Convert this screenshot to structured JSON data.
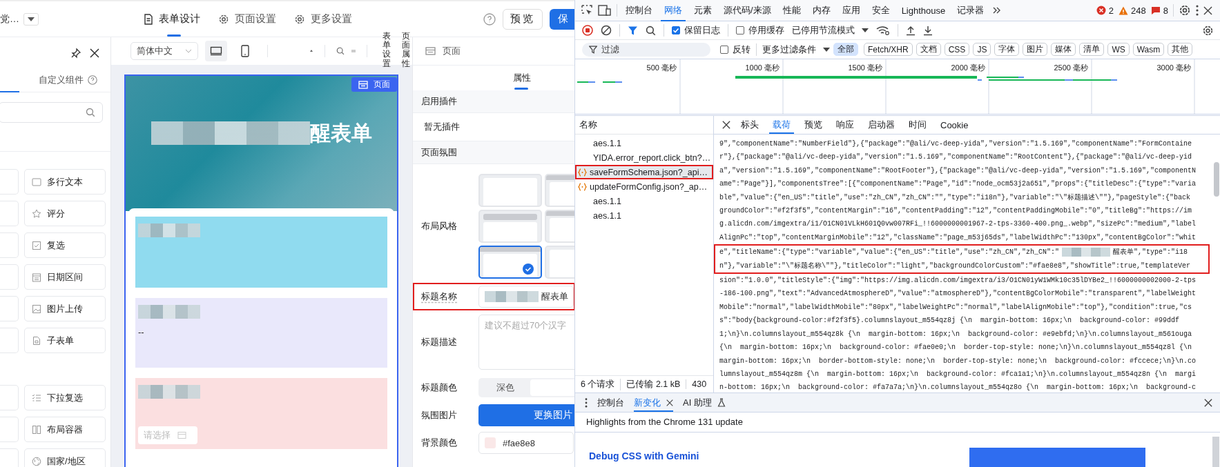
{
  "app": {
    "app_name": "党…",
    "tabs": [
      {
        "label": "表单设计",
        "selected": true
      },
      {
        "label": "页面设置",
        "selected": false
      },
      {
        "label": "更多设置",
        "selected": false
      }
    ],
    "preview_button": "预览",
    "save_button": "保",
    "component_panel": {
      "tab": "自定义组件",
      "groups": [
        [
          {
            "label": "多行文本"
          },
          {
            "label": "评分"
          },
          {
            "label": "复选"
          },
          {
            "label": "日期区间"
          },
          {
            "label": "图片上传"
          },
          {
            "label": "子表单"
          }
        ],
        [
          {
            "label": "下拉复选"
          },
          {
            "label": "布局容器"
          },
          {
            "label": "国家/地区"
          }
        ]
      ]
    },
    "canvas": {
      "language": "简体中文",
      "devices": [
        {
          "kind": "desktop",
          "selected": true
        },
        {
          "kind": "mobile",
          "selected": false
        }
      ],
      "side_labels": [
        "表单设置",
        "页面属性"
      ],
      "page_badge": "页面",
      "title_visible": "醒表单",
      "sections": [
        {
          "kind": "blank",
          "color": "#90dbef"
        },
        {
          "kind": "dash",
          "color": "#e9e8fb",
          "text": "--"
        },
        {
          "kind": "select",
          "color": "#fbdfe0",
          "placeholder": "请选择"
        }
      ]
    },
    "properties": {
      "header": "页面",
      "tab": "属性",
      "plugin_section": "启用插件",
      "plugin_empty": "暂无插件",
      "atmosphere_section": "页面氛围",
      "layout_label": "布局风格",
      "layout_styles": [
        {
          "kind": "plain",
          "selected": false
        },
        {
          "kind": "bar",
          "selected": false
        },
        {
          "kind": "inset-bar",
          "selected": false
        },
        {
          "kind": "bar",
          "selected": false
        },
        {
          "kind": "band",
          "selected": true
        },
        {
          "kind": "plain",
          "selected": false
        }
      ],
      "title_name": {
        "label": "标题名称",
        "value": "醒表单",
        "highlighted": true
      },
      "title_desc": {
        "label": "标题描述",
        "placeholder": "建议不超过70个汉字"
      },
      "title_color": {
        "label": "标题颜色",
        "options": [
          {
            "label": "深色",
            "selected": false
          },
          {
            "selected": true
          }
        ]
      },
      "atmosphere_image": {
        "label": "氛围图片",
        "button": "更换图片"
      },
      "background_color": {
        "label": "背景颜色",
        "value": "#fae8e8",
        "color": "#fae8e8"
      }
    }
  },
  "devtools": {
    "tabs": [
      {
        "label": "控制台",
        "selected": false
      },
      {
        "label": "网络",
        "selected": true
      },
      {
        "label": "元素",
        "selected": false
      },
      {
        "label": "源代码/来源",
        "selected": false
      },
      {
        "label": "性能",
        "selected": false
      },
      {
        "label": "内存",
        "selected": false
      },
      {
        "label": "应用",
        "selected": false
      },
      {
        "label": "安全",
        "selected": false
      },
      {
        "label": "Lighthouse",
        "selected": false
      },
      {
        "label": "记录器",
        "selected": false
      }
    ],
    "counts": [
      {
        "kind": "error",
        "value": "2"
      },
      {
        "kind": "warning",
        "value": "248"
      },
      {
        "kind": "issue",
        "value": "8"
      }
    ],
    "preserve_log": {
      "label": "保留日志",
      "checked": true
    },
    "disable_cache": {
      "label": "停用缓存",
      "checked": false
    },
    "throttling": "已停用节流模式",
    "filter": {
      "placeholder": "过滤",
      "invert": {
        "label": "反转",
        "checked": false
      },
      "more_filters": "更多过滤条件",
      "types": [
        {
          "label": "全部",
          "selected": true
        },
        {
          "label": "Fetch/XHR",
          "selected": false
        },
        {
          "label": "文档",
          "selected": false
        },
        {
          "label": "CSS",
          "selected": false
        },
        {
          "label": "JS",
          "selected": false
        },
        {
          "label": "字体",
          "selected": false
        },
        {
          "label": "图片",
          "selected": false
        },
        {
          "label": "媒体",
          "selected": false
        },
        {
          "label": "清单",
          "selected": false
        },
        {
          "label": "WS",
          "selected": false
        },
        {
          "label": "Wasm",
          "selected": false
        },
        {
          "label": "其他",
          "selected": false
        }
      ]
    },
    "timeline_ticks": [
      "500 毫秒",
      "1000 毫秒",
      "1500 毫秒",
      "2000 毫秒",
      "2500 毫秒",
      "3000 毫秒"
    ],
    "requests": {
      "header": "名称",
      "rows": [
        {
          "name": "aes.1.1",
          "kind": "plain",
          "selected": false,
          "highlighted": false
        },
        {
          "name": "YIDA.error_report.click_btn?…",
          "kind": "plain",
          "selected": false,
          "highlighted": false
        },
        {
          "name": "saveFormSchema.json?_api…",
          "kind": "json",
          "selected": true,
          "highlighted": true
        },
        {
          "name": "updateFormConfig.json?_ap…",
          "kind": "json",
          "selected": false,
          "highlighted": false
        },
        {
          "name": "aes.1.1",
          "kind": "plain",
          "selected": false,
          "highlighted": false
        },
        {
          "name": "aes.1.1",
          "kind": "plain",
          "selected": false,
          "highlighted": false
        }
      ],
      "summary": [
        "6 个请求",
        "已传输 2.1 kB",
        "430"
      ]
    },
    "detail": {
      "tabs": [
        {
          "label": "标头",
          "selected": false
        },
        {
          "label": "载荷",
          "selected": true
        },
        {
          "label": "预览",
          "selected": false
        },
        {
          "label": "响应",
          "selected": false
        },
        {
          "label": "启动器",
          "selected": false
        },
        {
          "label": "时间",
          "selected": false
        },
        {
          "label": "Cookie",
          "selected": false
        }
      ],
      "payload_lines": [
        {
          "text": "9\",\"componentName\":\"NumberField\"},{\"package\":\"@ali/vc-deep-yida\",\"version\":\"1.5.169\",\"componentName\":\"FormContaine",
          "highlighted": false
        },
        {
          "text": "r\"},{\"package\":\"@ali/vc-deep-yida\",\"version\":\"1.5.169\",\"componentName\":\"RootContent\"},{\"package\":\"@ali/vc-deep-yid",
          "highlighted": false
        },
        {
          "text": "a\",\"version\":\"1.5.169\",\"componentName\":\"RootFooter\"},{\"package\":\"@ali/vc-deep-yida\",\"version\":\"1.5.169\",\"componentN",
          "highlighted": false
        },
        {
          "text": "ame\":\"Page\"}],\"componentsTree\":[{\"componentName\":\"Page\",\"id\":\"node_ocm53j2a651\",\"props\":{\"titleDesc\":{\"type\":\"varia",
          "highlighted": false
        },
        {
          "text": "ble\",\"value\":{\"en_US\":\"title\",\"use\":\"zh_CN\",\"zh_CN\":\"\",\"type\":\"i18n\"},\"variable\":\"\\\"标题描述\\\"\"},\"pageStyle\":{\"back",
          "highlighted": false
        },
        {
          "text": "groundColor\":\"#f2f3f5\",\"contentMargin\":\"16\",\"contentPadding\":\"12\",\"contentPaddingMobile\":\"0\",\"titleBg\":\"https://im",
          "highlighted": false
        },
        {
          "text": "g.alicdn.com/imgextra/i1/O1CN01VLkH601Q0vw007RFi_!!6000000001967-2-tps-3360-400.png_.webp\",\"sizePc\":\"medium\",\"label",
          "highlighted": false
        },
        {
          "text": "AlignPc\":\"top\",\"contentMarginMobile\":\"12\",\"className\":\"page_m53j65ds\",\"labelWidthPc\":\"130px\",\"contentBgColor\":\"whit",
          "highlighted": false
        },
        {
          "text": "e\",\"titleName\":{\"type\":\"variable\",\"value\":{\"en_US\":\"title\",\"use\":\"zh_CN\",\"zh_CN\":\"",
          "after_redaction": "醒表单\",\"type\":\"i18",
          "highlighted": true
        },
        {
          "text": "n\"},\"variable\":\"\\\"标题名称\\\"\"},\"titleColor\":\"light\",\"backgroundColorCustom\":\"#fae8e8\",\"showTitle\":true,\"templateVer",
          "highlighted": true
        },
        {
          "text": "sion\":\"1.0.0\",\"titleStyle\":{\"img\":\"https://img.alicdn.com/imgextra/i3/O1CN01yW1WMk10c35lDYBe2_!!6000000002000-2-tps",
          "highlighted": false
        },
        {
          "text": "-186-100.png\",\"text\":\"AdvancedAtmosphereD\",\"value\":\"atmosphereD\"},\"contentBgColorMobile\":\"transparent\",\"labelWeight",
          "highlighted": false
        },
        {
          "text": "Mobile\":\"normal\",\"labelWidthMobile\":\"80px\",\"labelWeightPc\":\"normal\",\"labelAlignMobile\":\"top\"},\"condition\":true,\"cs",
          "highlighted": false
        },
        {
          "text": "s\":\"body{background-color:#f2f3f5}.columnslayout_m554qz8j {\\n  margin-bottom: 16px;\\n  background-color: #99ddf",
          "highlighted": false
        },
        {
          "text": "1;\\n}\\n.columnslayout_m554qz8k {\\n  margin-bottom: 16px;\\n  background-color: #e9ebfd;\\n}\\n.columnslayout_m561ouga",
          "highlighted": false
        },
        {
          "text": "{\\n  margin-bottom: 16px;\\n  background-color: #fae0e0;\\n  border-top-style: none;\\n}\\n.columnslayout_m554qz8l {\\n",
          "highlighted": false
        },
        {
          "text": "margin-bottom: 16px;\\n  border-bottom-style: none;\\n  border-top-style: none;\\n  background-color: #fccece;\\n}\\n.co",
          "highlighted": false
        },
        {
          "text": "lumnslayout_m554qz8m {\\n  margin-bottom: 16px;\\n  background-color: #fca1a1;\\n}\\n.columnslayout_m554qz8n {\\n  margi",
          "highlighted": false
        },
        {
          "text": "n-bottom: 16px;\\n  background-color: #fa7a7a;\\n}\\n.columnslayout_m554qz8o {\\n  margin-bottom: 16px;\\n  background-c",
          "highlighted": false
        }
      ]
    },
    "drawer": {
      "tabs": [
        {
          "label": "控制台",
          "selected": false,
          "closable": false,
          "experimental": false
        },
        {
          "label": "新变化",
          "selected": true,
          "closable": true,
          "experimental": false
        },
        {
          "label": "AI 助理",
          "selected": false,
          "closable": false,
          "experimental": true
        }
      ],
      "heading": "Highlights from the Chrome 131 update",
      "link": "Debug CSS with Gemini"
    }
  }
}
